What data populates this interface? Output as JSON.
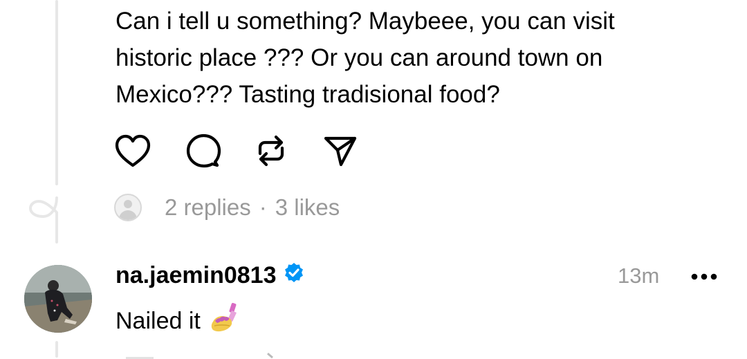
{
  "post": {
    "text": "Can i tell u something? Maybeee, you can visit historic place ??? Or you can around town on Mexico??? Tasting tradisional food?",
    "actions": [
      "heart-icon",
      "comment-icon",
      "repost-icon",
      "share-icon"
    ],
    "replies": "2 replies",
    "separator": "·",
    "likes": "3 likes"
  },
  "reply": {
    "username": "na.jaemin0813",
    "verified": true,
    "timestamp": "13m",
    "text": "Nailed it",
    "emoji": "nail-polish-emoji"
  },
  "colors": {
    "text": "#000000",
    "muted": "#999999",
    "thread_line": "#e7e7e7",
    "verified_blue": "#0095f6"
  }
}
